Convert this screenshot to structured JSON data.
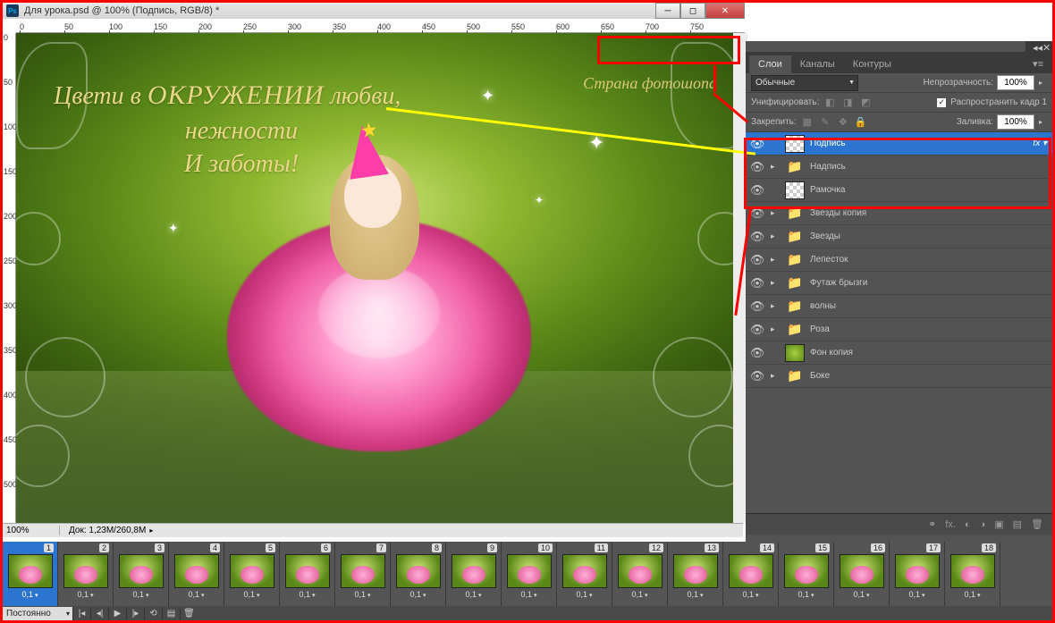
{
  "titlebar": {
    "title": "Для урока.psd @ 100% (Подпись, RGB/8) *",
    "app_icon": "Ps"
  },
  "ruler": {
    "marks": [
      0,
      50,
      100,
      150,
      200,
      250,
      300,
      350,
      400,
      450,
      500,
      550,
      600,
      650,
      700,
      750
    ],
    "vmarks": [
      0,
      50,
      100,
      150,
      200,
      250,
      300,
      350,
      400,
      450,
      500
    ]
  },
  "canvas": {
    "greeting": {
      "line1a": "Цвети в ",
      "line1b": "ОКРУЖЕНИИ",
      "line1c": " любви,",
      "line2": "нежности",
      "line3": "И  заботы!"
    },
    "signature": "Страна фотошопа"
  },
  "bottom_bar": {
    "zoom": "100%",
    "doc_info": "Док: 1,23M/260,8M"
  },
  "layers_panel": {
    "tabs": [
      "Слои",
      "Каналы",
      "Контуры"
    ],
    "blend_mode": "Обычные",
    "opacity_label": "Непрозрачность:",
    "opacity_value": "100%",
    "unify_label": "Унифицировать:",
    "propagate_label": "Распространить кадр 1",
    "lock_label": "Закрепить:",
    "fill_label": "Заливка:",
    "fill_value": "100%",
    "fx_label": "fx",
    "layers": [
      {
        "name": "Подпись",
        "thumb": "checker",
        "selected": true,
        "fx": true,
        "tri": false
      },
      {
        "name": "Надпись",
        "thumb": "folder",
        "tri": true
      },
      {
        "name": "Рамочка",
        "thumb": "checker",
        "tri": false
      },
      {
        "name": "Звезды копия",
        "thumb": "folder",
        "tri": true
      },
      {
        "name": "Звезды",
        "thumb": "folder",
        "tri": true
      },
      {
        "name": "Лепесток",
        "thumb": "folder",
        "tri": true
      },
      {
        "name": "Футаж брызги",
        "thumb": "folder",
        "tri": true
      },
      {
        "name": "волны",
        "thumb": "folder",
        "tri": true
      },
      {
        "name": "Роза",
        "thumb": "folder",
        "tri": true
      },
      {
        "name": "Фон копия",
        "thumb": "green",
        "tri": false
      },
      {
        "name": "Боке",
        "thumb": "folder",
        "tri": true
      }
    ]
  },
  "timeline": {
    "loop_mode": "Постоянно",
    "frames": [
      {
        "n": 1,
        "t": "0,1",
        "sel": true
      },
      {
        "n": 2,
        "t": "0,1"
      },
      {
        "n": 3,
        "t": "0,1"
      },
      {
        "n": 4,
        "t": "0,1"
      },
      {
        "n": 5,
        "t": "0,1"
      },
      {
        "n": 6,
        "t": "0,1"
      },
      {
        "n": 7,
        "t": "0,1"
      },
      {
        "n": 8,
        "t": "0,1"
      },
      {
        "n": 9,
        "t": "0,1"
      },
      {
        "n": 10,
        "t": "0,1"
      },
      {
        "n": 11,
        "t": "0,1"
      },
      {
        "n": 12,
        "t": "0,1"
      },
      {
        "n": 13,
        "t": "0,1"
      },
      {
        "n": 14,
        "t": "0,1"
      },
      {
        "n": 15,
        "t": "0,1"
      },
      {
        "n": 16,
        "t": "0,1"
      },
      {
        "n": 17,
        "t": "0,1"
      },
      {
        "n": 18,
        "t": "0,1"
      }
    ]
  }
}
